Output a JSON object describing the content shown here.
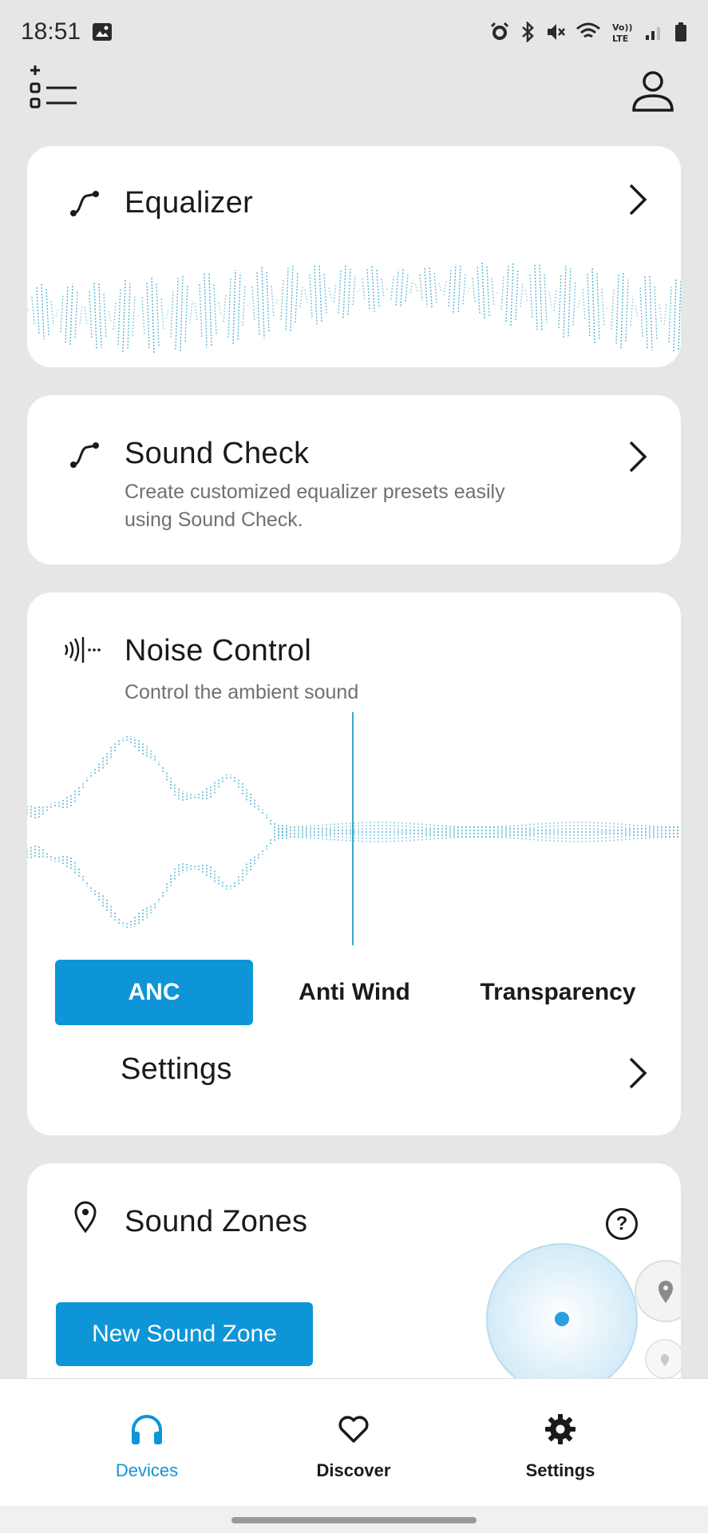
{
  "status_bar": {
    "time": "18:51"
  },
  "equalizer": {
    "title": "Equalizer"
  },
  "sound_check": {
    "title": "Sound Check",
    "subtitle_line1": "Create customized equalizer presets easily",
    "subtitle_line2": "using Sound Check."
  },
  "noise_control": {
    "title": "Noise Control",
    "subtitle": "Control the ambient sound",
    "modes": [
      "ANC",
      "Anti Wind",
      "Transparency"
    ],
    "selected_mode": "ANC",
    "settings_label": "Settings"
  },
  "sound_zones": {
    "title": "Sound Zones",
    "help_label": "?",
    "new_zone_button": "New Sound Zone"
  },
  "bottom_nav": {
    "items": [
      {
        "label": "Devices",
        "icon": "headphones-icon",
        "active": true
      },
      {
        "label": "Discover",
        "icon": "heart-icon",
        "active": false
      },
      {
        "label": "Settings",
        "icon": "gear-icon",
        "active": false
      }
    ]
  },
  "colors": {
    "accent": "#0e95d8",
    "background": "#e6e6e6",
    "card": "#ffffff",
    "wave": "#3aa7c9"
  }
}
